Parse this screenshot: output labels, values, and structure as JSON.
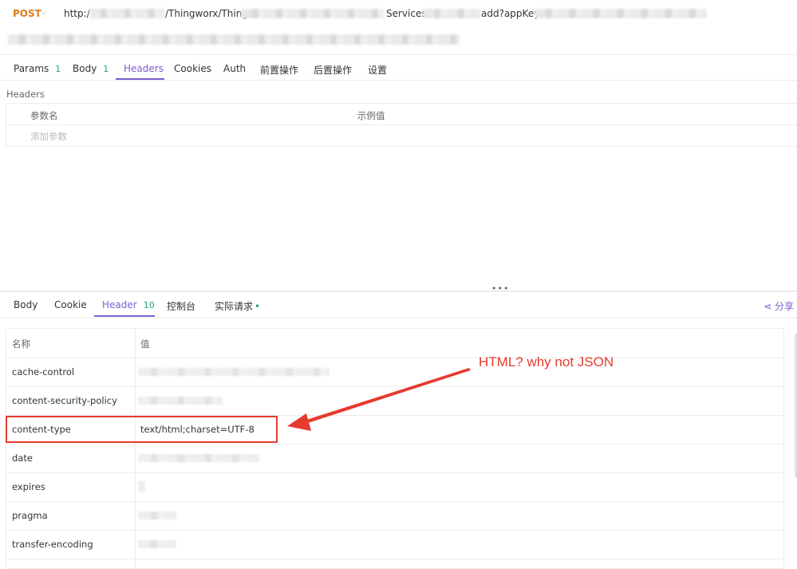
{
  "request": {
    "method": "POST",
    "url_parts": [
      "http:/",
      "/Thingworx/Things",
      "Services/",
      "add?appKey="
    ]
  },
  "request_tabs": [
    {
      "label": "Params",
      "count": "1"
    },
    {
      "label": "Body",
      "count": "1"
    },
    {
      "label": "Headers",
      "count": ""
    },
    {
      "label": "Cookies",
      "count": ""
    },
    {
      "label": "Auth",
      "count": ""
    },
    {
      "label": "前置操作",
      "count": ""
    },
    {
      "label": "后置操作",
      "count": ""
    },
    {
      "label": "设置",
      "count": ""
    }
  ],
  "request_active_tab": "Headers",
  "headers_section": {
    "label": "Headers",
    "col_name": "参数名",
    "col_example": "示例值",
    "add_placeholder": "添加参数"
  },
  "response_tabs": [
    {
      "label": "Body",
      "count": ""
    },
    {
      "label": "Cookie",
      "count": ""
    },
    {
      "label": "Header",
      "count": "10"
    },
    {
      "label": "控制台",
      "count": ""
    },
    {
      "label": "实际请求",
      "count": ""
    }
  ],
  "response_active_tab": "Header",
  "share_label": "分享",
  "response_headers": {
    "col_name": "名称",
    "col_value": "值",
    "rows": [
      {
        "name": "cache-control",
        "value": ""
      },
      {
        "name": "content-security-policy",
        "value": ""
      },
      {
        "name": "content-type",
        "value": "text/html;charset=UTF-8"
      },
      {
        "name": "date",
        "value": ""
      },
      {
        "name": "expires",
        "value": ""
      },
      {
        "name": "pragma",
        "value": ""
      },
      {
        "name": "transfer-encoding",
        "value": ""
      }
    ]
  },
  "annotation": {
    "text": "HTML?  why not JSON",
    "color": "#e63a2e"
  },
  "colors": {
    "accent": "#7b5ecf",
    "method": "#e07a1a",
    "count": "#2aa06f"
  }
}
